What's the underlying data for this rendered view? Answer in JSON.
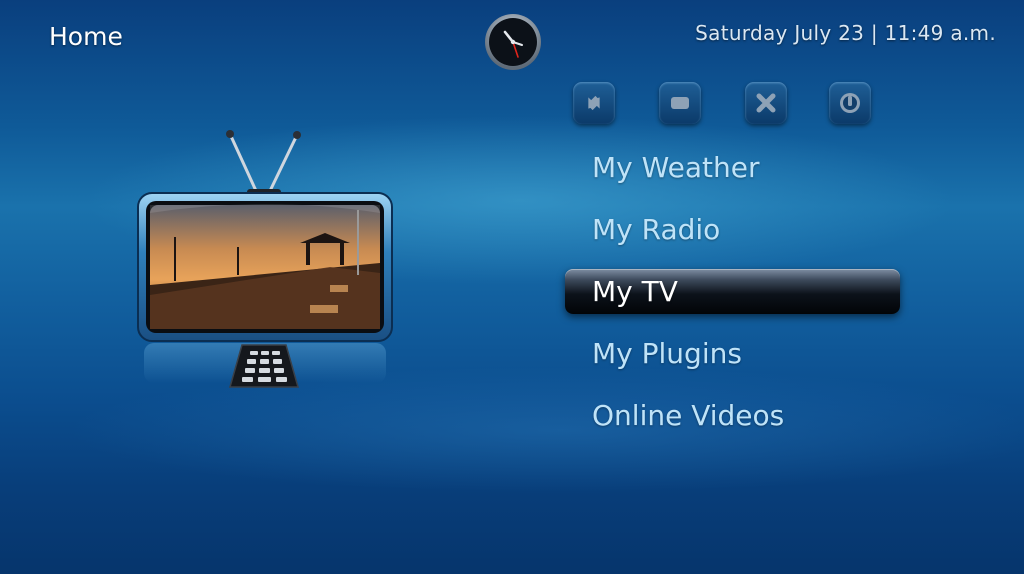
{
  "header": {
    "title": "Home",
    "datetime": "Saturday July 23 | 11:49 a.m."
  },
  "toolbar": {
    "buttons": [
      {
        "name": "refresh",
        "icon": "refresh-icon"
      },
      {
        "name": "fullscreen",
        "icon": "screen-icon"
      },
      {
        "name": "close",
        "icon": "close-icon"
      },
      {
        "name": "power",
        "icon": "power-icon"
      }
    ]
  },
  "menu": {
    "items": [
      {
        "label": "My Weather",
        "selected": false
      },
      {
        "label": "My Radio",
        "selected": false
      },
      {
        "label": "My TV",
        "selected": true
      },
      {
        "label": "My Plugins",
        "selected": false
      },
      {
        "label": "Online Videos",
        "selected": false
      }
    ]
  },
  "colors": {
    "background": "#0f5a98",
    "menu_text": "#bfe3f8",
    "selected_text": "#ffffff",
    "clock_hand_seconds": "#e2241b"
  },
  "illustration": {
    "icon": "tv-icon"
  }
}
